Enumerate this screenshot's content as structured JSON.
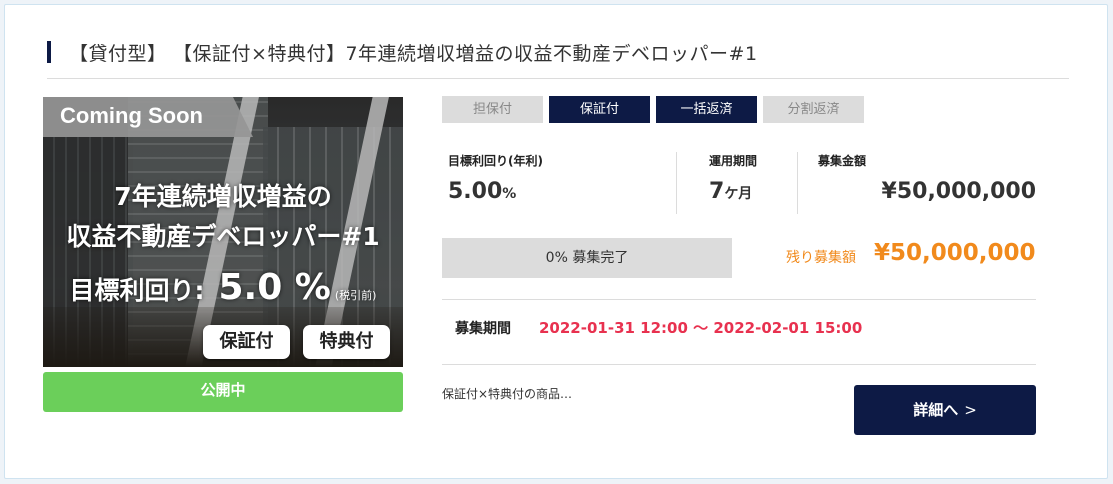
{
  "title": "【貸付型】 【保証付×特典付】7年連続増収増益の収益不動産デベロッパー#1",
  "image": {
    "ribbon": "Coming Soon",
    "headline_line1": "7年連続増収増益の",
    "headline_line2": "収益不動産デベロッパー#1",
    "yield_label": "目標利回り:",
    "yield_value": "5.0 %",
    "yield_note": "(税引前)",
    "pill_guarantee": "保証付",
    "pill_benefit": "特典付"
  },
  "status": "公開中",
  "tags": [
    {
      "label": "担保付",
      "active": false
    },
    {
      "label": "保証付",
      "active": true
    },
    {
      "label": "一括返済",
      "active": true
    },
    {
      "label": "分割返済",
      "active": false
    }
  ],
  "stats": {
    "yield_label": "目標利回り(年利)",
    "yield_value": "5.00",
    "yield_unit": "%",
    "period_label": "運用期間",
    "period_value": "7",
    "period_unit": "ケ月",
    "amount_label": "募集金額",
    "amount_value": "¥50,000,000"
  },
  "progress": {
    "percent": 0,
    "text": "0% 募集完了"
  },
  "remaining": {
    "label": "残り募集額",
    "value": "¥50,000,000"
  },
  "recruit_period": {
    "label": "募集期間",
    "value": "2022-01-31 12:00 ～ 2022-02-01 15:00"
  },
  "description": "保証付×特典付の商品…",
  "detail_button": {
    "label": "詳細へ",
    "chevron": ">"
  },
  "colors": {
    "navy": "#0d1a45",
    "orange": "#f18a1c",
    "red": "#e8314f",
    "green": "#6bcf5a"
  }
}
